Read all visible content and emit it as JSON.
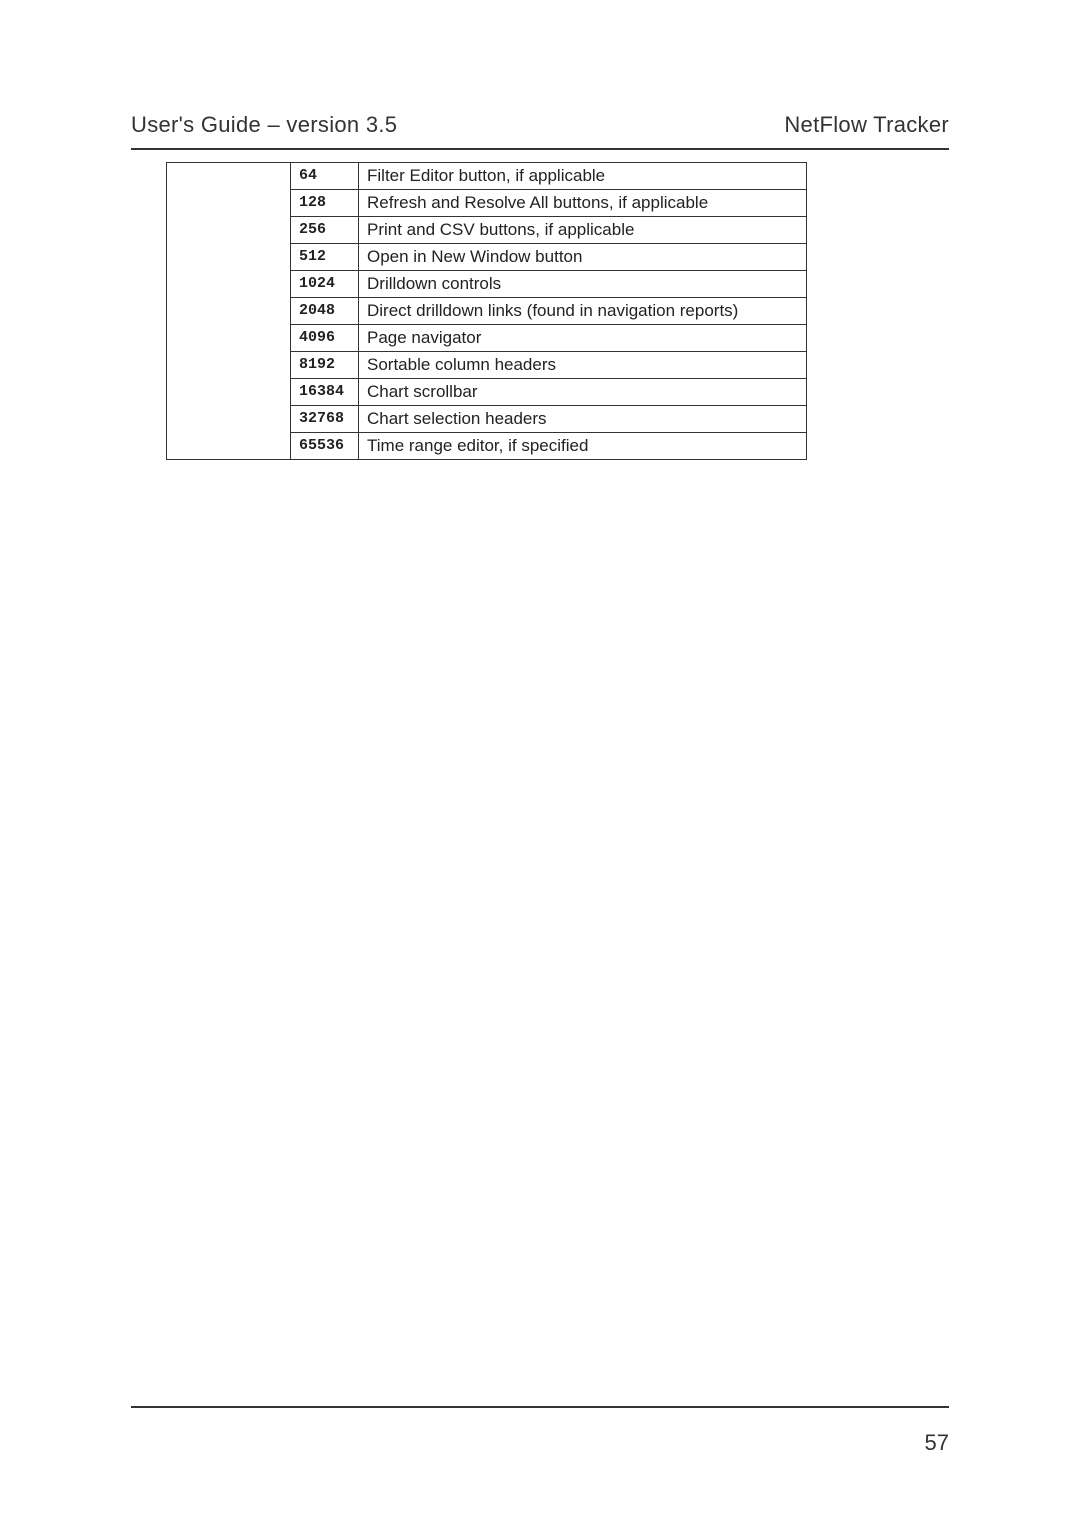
{
  "header": {
    "left": "User's Guide – version 3.5",
    "right": "NetFlow Tracker"
  },
  "table": {
    "rows": [
      {
        "code": "64",
        "desc": "Filter Editor button, if applicable"
      },
      {
        "code": "128",
        "desc": "Refresh and Resolve All buttons, if applicable"
      },
      {
        "code": "256",
        "desc": "Print and CSV buttons, if applicable"
      },
      {
        "code": "512",
        "desc": "Open in New Window button"
      },
      {
        "code": "1024",
        "desc": "Drilldown controls"
      },
      {
        "code": "2048",
        "desc": "Direct drilldown links (found in navigation reports)"
      },
      {
        "code": "4096",
        "desc": "Page navigator"
      },
      {
        "code": "8192",
        "desc": "Sortable column headers"
      },
      {
        "code": "16384",
        "desc": "Chart scrollbar"
      },
      {
        "code": "32768",
        "desc": "Chart selection headers"
      },
      {
        "code": "65536",
        "desc": "Time range editor, if specified"
      }
    ]
  },
  "page_number": "57"
}
